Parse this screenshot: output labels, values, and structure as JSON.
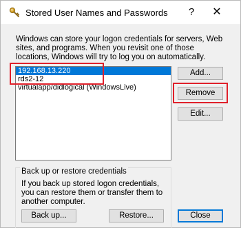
{
  "window": {
    "title": "Stored User Names and Passwords",
    "help_glyph": "?",
    "close_glyph": "✕"
  },
  "intro_text": "Windows can store your logon credentials for servers, Web sites, and programs. When you revisit one of those locations, Windows will try to log you on automatically.",
  "credentials": {
    "items": [
      {
        "label": "192.168.13.220",
        "selected": true
      },
      {
        "label": "rds2-12",
        "selected": false
      },
      {
        "label": "virtualapp/didlogical (WindowsLive)",
        "selected": false
      }
    ]
  },
  "buttons": {
    "add": "Add...",
    "remove": "Remove",
    "edit": "Edit...",
    "backup": "Back up...",
    "restore": "Restore...",
    "close": "Close"
  },
  "backup_group": {
    "title": "Back up or restore credentials",
    "text": "If you back up stored logon credentials, you can restore them or transfer them to another computer."
  },
  "colors": {
    "selection": "#0078d7",
    "annotation_highlight": "#e0202a"
  },
  "icons": {
    "title": "key-icon"
  }
}
